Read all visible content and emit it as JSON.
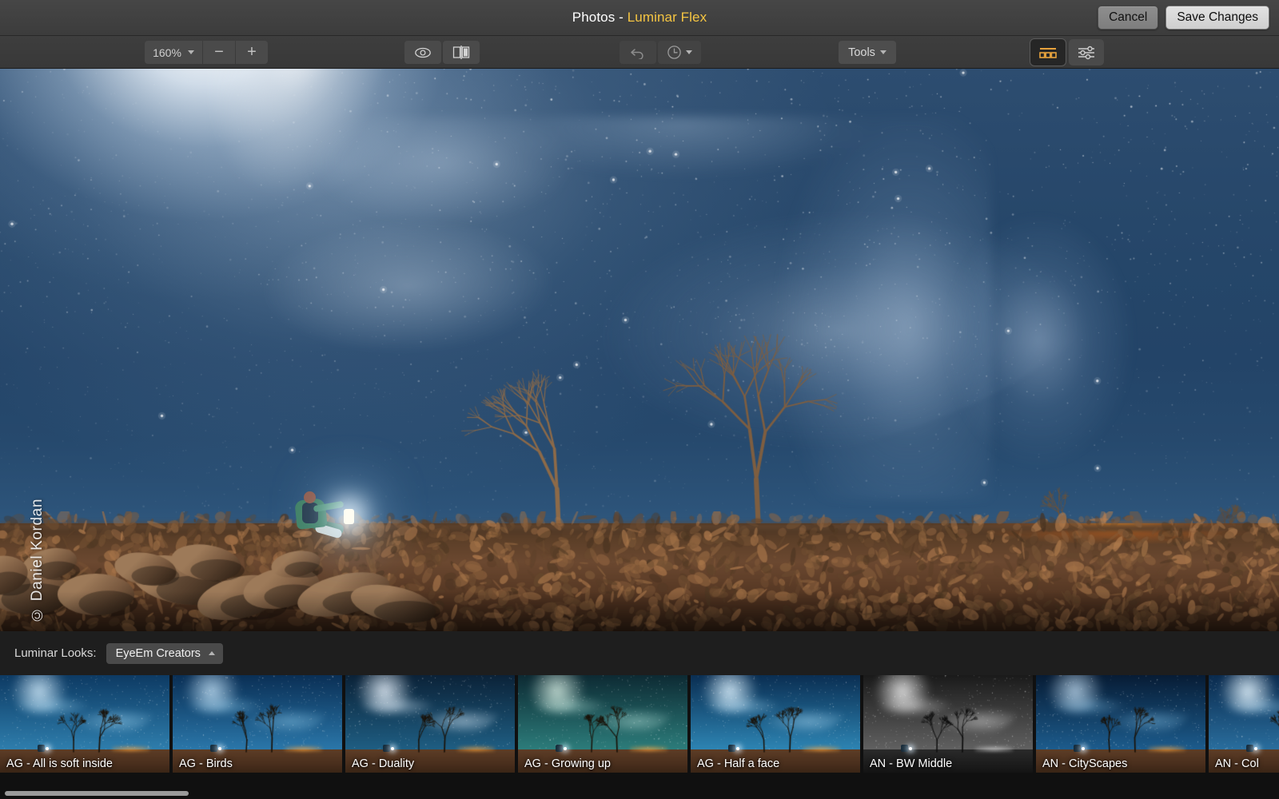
{
  "window": {
    "title_prefix": "Photos - ",
    "title_app": "Luminar Flex",
    "cancel_label": "Cancel",
    "save_label": "Save Changes"
  },
  "toolbar": {
    "zoom_value": "160%",
    "zoom_out_label": "−",
    "zoom_in_label": "+",
    "preview_icon": "eye-icon",
    "compare_icon": "before-after-split-icon",
    "undo_icon": "undo-arrow-icon",
    "history_icon": "clock-history-icon",
    "tools_label": "Tools",
    "looks_panel_icon": "looks-presets-icon",
    "edit_panel_icon": "adjustment-sliders-icon",
    "accent_color": "#e8a33d"
  },
  "canvas": {
    "watermark": "© Daniel Kordan"
  },
  "looks": {
    "label": "Luminar Looks:",
    "collection_value": "EyeEm Creators",
    "collection_caret": "chevron-up-icon"
  },
  "filmstrip": {
    "items": [
      {
        "label": "AG - All is soft inside",
        "sky_top": "#0d3a63",
        "sky_bottom": "#2f7fae",
        "mw": "rgba(150,205,235,0.55)",
        "glow": "rgba(215,240,255,0.85)"
      },
      {
        "label": "AG - Birds",
        "sky_top": "#0a2f55",
        "sky_bottom": "#2b78ab",
        "mw": "rgba(140,200,232,0.50)",
        "glow": "rgba(205,235,255,0.80)"
      },
      {
        "label": "AG - Duality",
        "sky_top": "#0b2238",
        "sky_bottom": "#1f5f84",
        "mw": "rgba(205,225,240,0.58)",
        "glow": "rgba(235,245,255,0.88)"
      },
      {
        "label": "AG - Growing up",
        "sky_top": "#0d2a33",
        "sky_bottom": "#2d7e7c",
        "mw": "rgba(178,224,216,0.52)",
        "glow": "rgba(226,248,236,0.82)"
      },
      {
        "label": "AG - Half a face",
        "sky_top": "#0a2e52",
        "sky_bottom": "#2e86b5",
        "mw": "rgba(160,210,238,0.55)",
        "glow": "rgba(220,242,255,0.90)"
      },
      {
        "label": "AN - BW Middle",
        "sky_top": "#1a1a1a",
        "sky_bottom": "#626262",
        "mw": "rgba(225,225,225,0.50)",
        "glow": "rgba(250,250,250,0.85)"
      },
      {
        "label": "AN - CityScapes",
        "sky_top": "#071c35",
        "sky_bottom": "#1d5d8e",
        "mw": "rgba(130,190,226,0.48)",
        "glow": "rgba(205,232,252,0.78)"
      },
      {
        "label": "AN - Col",
        "sky_top": "#0a2a4d",
        "sky_bottom": "#2a6f9f",
        "mw": "rgba(165,212,240,0.52)",
        "glow": "rgba(228,245,255,0.92)"
      }
    ]
  }
}
